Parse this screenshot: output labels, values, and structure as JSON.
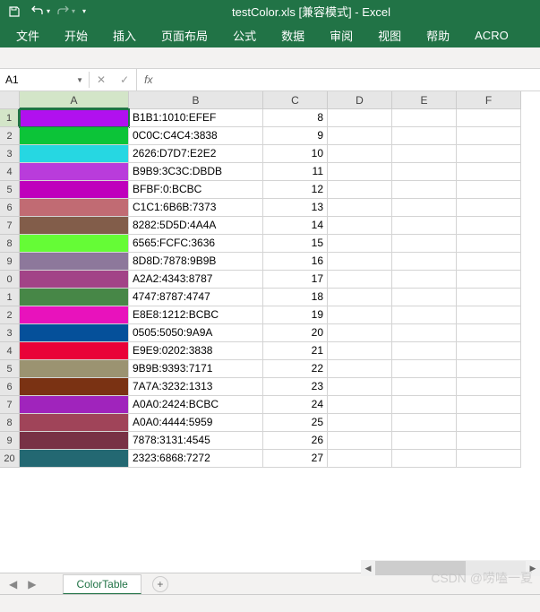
{
  "title": "testColor.xls  [兼容模式]  -  Excel",
  "qat": {
    "undo": "↶",
    "redo": "↷"
  },
  "ribbon": {
    "tabs": [
      "文件",
      "开始",
      "插入",
      "页面布局",
      "公式",
      "数据",
      "审阅",
      "视图",
      "帮助",
      "ACRO"
    ]
  },
  "formula_bar": {
    "name_box": "A1",
    "fx": "fx"
  },
  "columns": [
    "A",
    "B",
    "C",
    "D",
    "E",
    "F"
  ],
  "sheet": {
    "active_tab": "ColorTable",
    "new": "+"
  },
  "watermark": "CSDN @唠嗑一夏",
  "rows": [
    {
      "n": "1",
      "color": "#B110EF",
      "b": "B1B1:1010:EFEF",
      "c": "8"
    },
    {
      "n": "2",
      "color": "#0CC438",
      "b": "0C0C:C4C4:3838",
      "c": "9"
    },
    {
      "n": "3",
      "color": "#26D7E2",
      "b": "2626:D7D7:E2E2",
      "c": "10"
    },
    {
      "n": "4",
      "color": "#B93CDB",
      "b": "B9B9:3C3C:DBDB",
      "c": "11"
    },
    {
      "n": "5",
      "color": "#BF00BC",
      "b": "BFBF:0:BCBC",
      "c": "12"
    },
    {
      "n": "6",
      "color": "#C16B73",
      "b": "C1C1:6B6B:7373",
      "c": "13"
    },
    {
      "n": "7",
      "color": "#825D4A",
      "b": "8282:5D5D:4A4A",
      "c": "14"
    },
    {
      "n": "8",
      "color": "#65FC36",
      "b": "6565:FCFC:3636",
      "c": "15"
    },
    {
      "n": "9",
      "color": "#8D789B",
      "b": "8D8D:7878:9B9B",
      "c": "16"
    },
    {
      "n": "0",
      "color": "#A24387",
      "b": "A2A2:4343:8787",
      "c": "17"
    },
    {
      "n": "1",
      "color": "#478747",
      "b": "4747:8787:4747",
      "c": "18"
    },
    {
      "n": "2",
      "color": "#E812BC",
      "b": "E8E8:1212:BCBC",
      "c": "19"
    },
    {
      "n": "3",
      "color": "#05509A",
      "b": "0505:5050:9A9A",
      "c": "20"
    },
    {
      "n": "4",
      "color": "#E90238",
      "b": "E9E9:0202:3838",
      "c": "21"
    },
    {
      "n": "5",
      "color": "#9B9371",
      "b": "9B9B:9393:7171",
      "c": "22"
    },
    {
      "n": "6",
      "color": "#7A3213",
      "b": "7A7A:3232:1313",
      "c": "23"
    },
    {
      "n": "7",
      "color": "#A024BC",
      "b": "A0A0:2424:BCBC",
      "c": "24"
    },
    {
      "n": "8",
      "color": "#A04459",
      "b": "A0A0:4444:5959",
      "c": "25"
    },
    {
      "n": "9",
      "color": "#783145",
      "b": "7878:3131:4545",
      "c": "26"
    },
    {
      "n": "20",
      "color": "#236872",
      "b": "2323:6868:7272",
      "c": "27"
    }
  ]
}
